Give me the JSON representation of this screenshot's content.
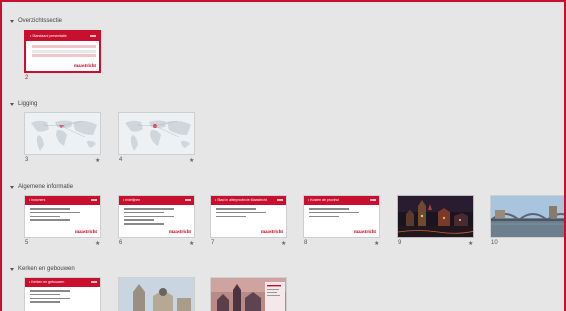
{
  "sections": [
    {
      "label": "Overzichtssectie"
    },
    {
      "label": "Ligging"
    },
    {
      "label": "Algemene informatie"
    },
    {
      "label": "Kerken en gebouwen"
    }
  ],
  "slides": [
    {
      "number": "2",
      "title": "• Standaard presentatie",
      "brand": "maastricht"
    },
    {
      "number": "3",
      "star": "★"
    },
    {
      "number": "4",
      "star": "★"
    },
    {
      "number": "5",
      "title": "• Inwoners",
      "brand": "maastricht",
      "star": "★"
    },
    {
      "number": "6",
      "title": "• Indelijnen",
      "brand": "maastricht",
      "star": "★"
    },
    {
      "number": "7",
      "title": "• Stad in allerprovincie Maastricht",
      "brand": "maastricht",
      "star": "★"
    },
    {
      "number": "8",
      "title": "• Kosten de provinci",
      "brand": "maastricht",
      "star": "★"
    },
    {
      "number": "9",
      "star": "★"
    },
    {
      "number": "10"
    },
    {
      "title": "• Kerken en gebouwen"
    },
    {},
    {}
  ],
  "colors": {
    "accent": "#c8102e",
    "background": "#e6e6e6"
  }
}
